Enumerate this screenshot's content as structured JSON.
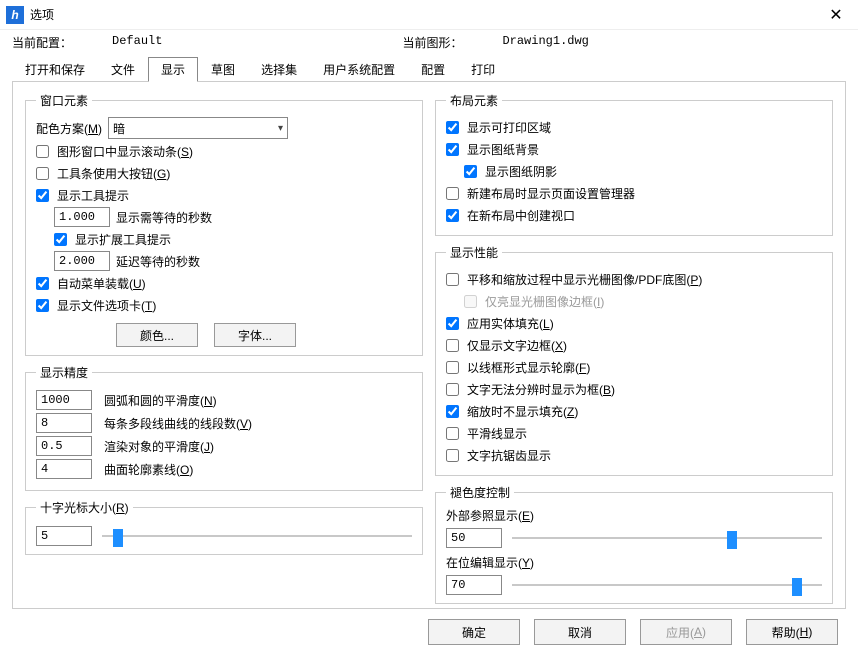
{
  "title": "选项",
  "close_glyph": "✕",
  "header": {
    "config_label": "当前配置：",
    "config_value": "Default",
    "drawing_label": "当前图形：",
    "drawing_value": "Drawing1.dwg"
  },
  "tabs": {
    "open_save": "打开和保存",
    "files": "文件",
    "display": "显示",
    "sketch": "草图",
    "selection": "选择集",
    "user_sys": "用户系统配置",
    "configs": "配置",
    "print": "打印"
  },
  "window_elements": {
    "legend": "窗口元素",
    "color_scheme_label": "配色方案(M)",
    "color_scheme_value": "暗",
    "show_scroll": "图形窗口中显示滚动条(S)",
    "large_buttons": "工具条使用大按钮(G)",
    "show_tooltips": "显示工具提示",
    "tooltip_delay_value": "1.000",
    "tooltip_delay_label": "显示需等待的秒数",
    "show_ext_tooltip": "显示扩展工具提示",
    "ext_tooltip_delay_value": "2.000",
    "ext_tooltip_delay_label": "延迟等待的秒数",
    "auto_menu": "自动菜单装载(U)",
    "show_file_tabs": "显示文件选项卡(T)",
    "btn_color": "颜色...",
    "btn_font": "字体..."
  },
  "precision": {
    "legend": "显示精度",
    "arc_value": "1000",
    "arc_label": "圆弧和圆的平滑度(N)",
    "polyline_value": "8",
    "polyline_label": "每条多段线曲线的线段数(V)",
    "render_value": "0.5",
    "render_label": "渲染对象的平滑度(J)",
    "surface_value": "4",
    "surface_label": "曲面轮廓素线(O)"
  },
  "crosshair": {
    "legend": "十字光标大小(R)",
    "value": "5",
    "percent": 5
  },
  "layout_elems": {
    "legend": "布局元素",
    "show_printable": "显示可打印区域",
    "show_paper_bg": "显示图纸背景",
    "show_paper_shadow": "显示图纸阴影",
    "new_layout_dlg": "新建布局时显示页面设置管理器",
    "create_viewport": "在新布局中创建视口"
  },
  "perf": {
    "legend": "显示性能",
    "pan_raster": "平移和缩放过程中显示光栅图像/PDF底图(P)",
    "highlight_raster": "仅亮显光栅图像边框(I)",
    "apply_solid_fill": "应用实体填充(L)",
    "text_frame_only": "仅显示文字边框(X)",
    "wireframe_silh": "以线框形式显示轮廓(F)",
    "text_unreadable": "文字无法分辨时显示为框(B)",
    "no_fill_zoom": "缩放时不显示填充(Z)",
    "smooth_line": "平滑线显示",
    "text_aa": "文字抗锯齿显示"
  },
  "fade": {
    "legend": "褪色度控制",
    "xref_label": "外部参照显示(E)",
    "xref_value": "50",
    "xref_percent": 71,
    "inplace_label": "在位编辑显示(Y)",
    "inplace_value": "70",
    "inplace_percent": 92
  },
  "buttons": {
    "ok": "确定",
    "cancel": "取消",
    "apply": "应用(A)",
    "help": "帮助(H)"
  }
}
